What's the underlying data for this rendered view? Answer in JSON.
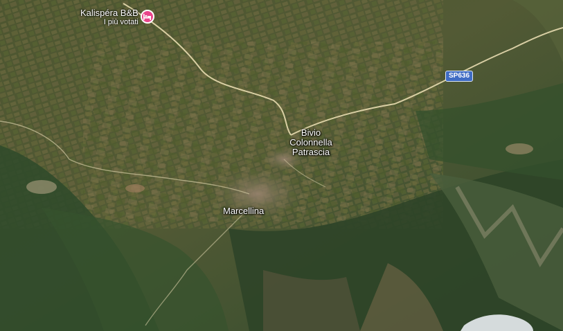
{
  "map": {
    "colors": {
      "poi_pin": "#e8458b",
      "road_shield": "#3f6cc4",
      "road": "#e8dcb0"
    },
    "pois": [
      {
        "name": "Kalispéra B&B",
        "subtitle": "I più votati",
        "icon": "hotel-bed-icon"
      }
    ],
    "places": [
      {
        "id": "bivio",
        "lines": [
          "Bivio",
          "Colonnella",
          "Patrascia"
        ]
      },
      {
        "id": "marcellina",
        "lines": [
          "Marcellina"
        ]
      }
    ],
    "road_shields": [
      {
        "label": "SP636"
      }
    ]
  }
}
